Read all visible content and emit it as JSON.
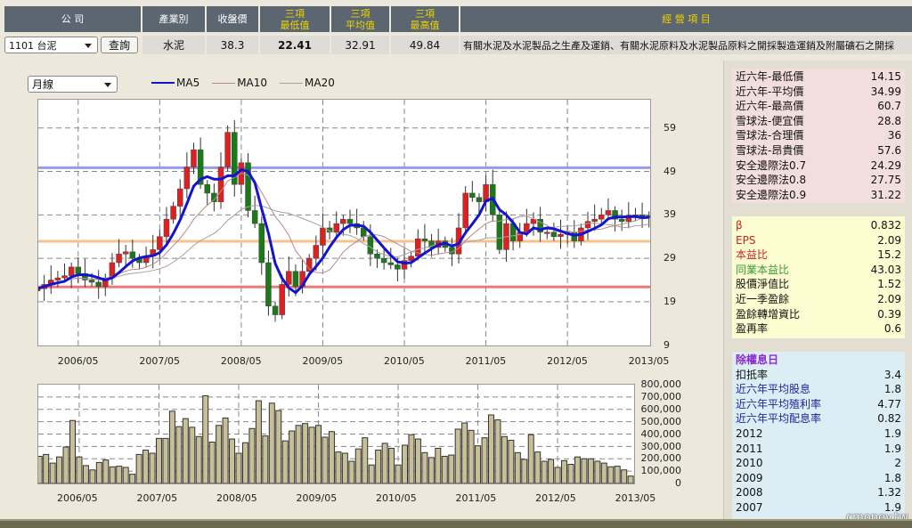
{
  "header": {
    "company": "公 司",
    "industry": "產業別",
    "close": "收盤價",
    "min3_line1": "三項",
    "min3_line2": "最低值",
    "avg3_line1": "三項",
    "avg3_line2": "平均值",
    "max3_line1": "三項",
    "max3_line2": "最高值",
    "business": "經 營 項 目"
  },
  "row": {
    "stock_select": "1101 台泥",
    "query_button": "查詢",
    "industry": "水泥",
    "close": "38.3",
    "min3": "22.41",
    "avg3": "32.91",
    "max3": "49.84",
    "business": "有關水泥及水泥製品之生產及運銷、有關水泥原料及水泥製品原料之開採製造運銷及附屬礦石之開採"
  },
  "period_select": "月線",
  "legend": {
    "ma5": "MA5",
    "ma10": "MA10",
    "ma20": "MA20"
  },
  "colors": {
    "up": "#e02020",
    "down": "#1a7a1a",
    "ma5": "#1414d0",
    "ma10": "#b88a8a",
    "ma20": "#a8a29a",
    "line_high": "#9a9ae8",
    "line_avg": "#f5c28e",
    "line_low": "#ea7a7a",
    "volume": "#c8bf98"
  },
  "chart_data": [
    {
      "type": "candlestick",
      "x_ticks": [
        "2006/05",
        "2007/05",
        "2008/05",
        "2009/05",
        "2010/05",
        "2011/05",
        "2012/05",
        "2013/05"
      ],
      "y_ticks": [
        "59",
        "49",
        "39",
        "29",
        "19",
        "9"
      ],
      "ylim": [
        9,
        65
      ],
      "reference_lines": [
        49.84,
        32.91,
        22.41
      ],
      "close": [
        22,
        23,
        24,
        24.5,
        25,
        27,
        25.5,
        24,
        23.5,
        22.5,
        24.5,
        28,
        30,
        30.5,
        29,
        28,
        29.5,
        31,
        34,
        38,
        41,
        45,
        50,
        54,
        46,
        44,
        42,
        50,
        58,
        46,
        51,
        40,
        37,
        28,
        18,
        16,
        23,
        26,
        22.5,
        26,
        29,
        32,
        36,
        35,
        37,
        38,
        37,
        36,
        34,
        30,
        29,
        28,
        27.5,
        26.5,
        28.5,
        29.5,
        33.5,
        33,
        31.5,
        33,
        31.5,
        30,
        36,
        44,
        43,
        42,
        46,
        39,
        31,
        37,
        33,
        35,
        37,
        38,
        35,
        35,
        34,
        34.5,
        35,
        33,
        36,
        37.5,
        38,
        39,
        40,
        38,
        37.5,
        38.5,
        39,
        38.8,
        38.3
      ]
    },
    {
      "type": "bar",
      "x_ticks": [
        "2006/05",
        "2007/05",
        "2008/05",
        "2009/05",
        "2010/05",
        "2011/05",
        "2012/05",
        "2013/05"
      ],
      "y_ticks": [
        "800,000",
        "700,000",
        "600,000",
        "500,000",
        "400,000",
        "300,000",
        "200,000",
        "100,000",
        "0"
      ],
      "ylim": [
        0,
        800000
      ],
      "values": [
        220000,
        235000,
        165000,
        215000,
        295000,
        510000,
        215000,
        145000,
        110000,
        170000,
        190000,
        135000,
        140000,
        130000,
        75000,
        235000,
        270000,
        245000,
        365000,
        365000,
        585000,
        460000,
        525000,
        455000,
        380000,
        710000,
        335000,
        470000,
        530000,
        360000,
        245000,
        330000,
        445000,
        670000,
        385000,
        650000,
        590000,
        345000,
        425000,
        470000,
        485000,
        455000,
        470000,
        375000,
        420000,
        255000,
        245000,
        180000,
        280000,
        370000,
        150000,
        270000,
        325000,
        285000,
        150000,
        310000,
        395000,
        360000,
        250000,
        210000,
        285000,
        220000,
        230000,
        440000,
        490000,
        430000,
        305000,
        370000,
        555000,
        515000,
        380000,
        350000,
        250000,
        195000,
        395000,
        255000,
        180000,
        195000,
        130000,
        185000,
        155000,
        215000,
        200000,
        200000,
        180000,
        165000,
        135000,
        140000,
        110000,
        60000,
        10000
      ]
    }
  ],
  "valuation": [
    {
      "label": "近六年-最低價",
      "value": "14.15"
    },
    {
      "label": "近六年-平均價",
      "value": "34.99"
    },
    {
      "label": "近六年-最高價",
      "value": "60.7"
    },
    {
      "label": "雪球法-便宜價",
      "value": "28.8"
    },
    {
      "label": "雪球法-合理價",
      "value": "36"
    },
    {
      "label": "雪球法-昂貴價",
      "value": "57.6"
    },
    {
      "label": "安全邊際法0.7",
      "value": "24.29"
    },
    {
      "label": "安全邊際法0.8",
      "value": "27.75"
    },
    {
      "label": "安全邊際法0.9",
      "value": "31.22"
    }
  ],
  "ratios": [
    {
      "label": "β",
      "value": "0.832",
      "color": "#d02020"
    },
    {
      "label": "EPS",
      "value": "2.09",
      "color": "#d02020"
    },
    {
      "label": "本益比",
      "value": "15.2",
      "color": "#d02020"
    },
    {
      "label": "同業本益比",
      "value": "43.03",
      "color": "#3a9a3a"
    },
    {
      "label": "股價淨值比",
      "value": "1.52",
      "color": "#111111"
    },
    {
      "label": "近一季盈餘",
      "value": "2.09",
      "color": "#111111"
    },
    {
      "label": "盈餘轉增資比",
      "value": "0.39",
      "color": "#111111"
    },
    {
      "label": "盈再率",
      "value": "0.6",
      "color": "#111111"
    }
  ],
  "dividends": {
    "title": "除權息日",
    "rows": [
      {
        "label": "扣抵率",
        "value": "3.4",
        "color": "#111111"
      },
      {
        "label": "近六年平均股息",
        "value": "1.8",
        "color": "#2020a0"
      },
      {
        "label": "近六年平均殖利率",
        "value": "4.77",
        "color": "#2020a0"
      },
      {
        "label": "近六年平均配息率",
        "value": "0.82",
        "color": "#2020a0"
      },
      {
        "label": "2012",
        "value": "1.9",
        "color": "#111111"
      },
      {
        "label": "2011",
        "value": "1.9",
        "color": "#111111"
      },
      {
        "label": "2010",
        "value": "2",
        "color": "#111111"
      },
      {
        "label": "2009",
        "value": "1.8",
        "color": "#111111"
      },
      {
        "label": "2008",
        "value": "1.32",
        "color": "#111111"
      },
      {
        "label": "2007",
        "value": "1.9",
        "color": "#111111"
      }
    ]
  },
  "watermark": "cmoney.tw"
}
